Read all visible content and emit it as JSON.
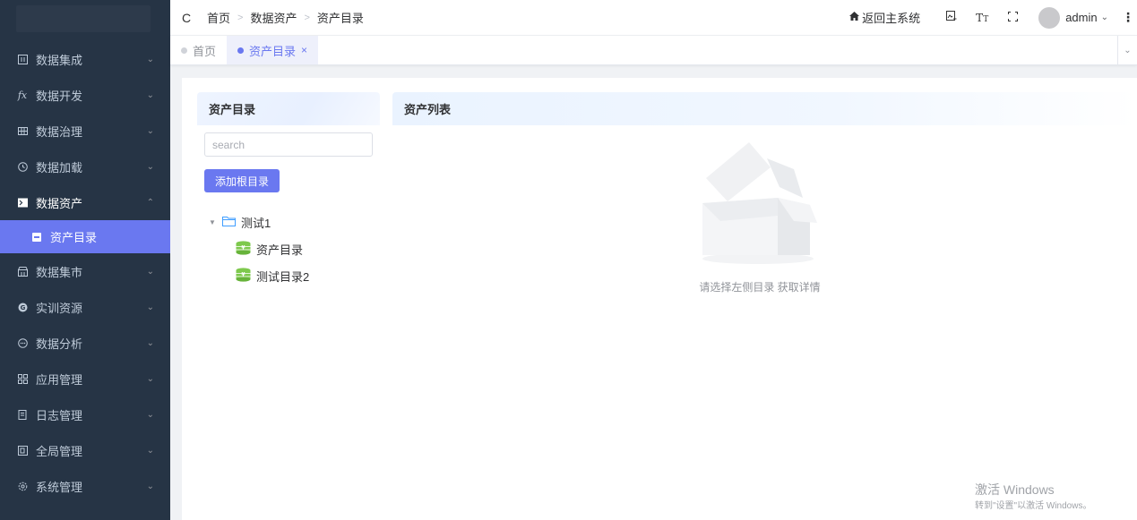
{
  "sidebar": {
    "items": [
      {
        "label": "数据集成",
        "icon": "grid-icon"
      },
      {
        "label": "数据开发",
        "icon": "fx-icon"
      },
      {
        "label": "数据治理",
        "icon": "table-icon"
      },
      {
        "label": "数据加载",
        "icon": "clock-icon"
      },
      {
        "label": "数据资产",
        "icon": "terminal-icon",
        "open": true
      },
      {
        "label": "数据集市",
        "icon": "store-icon"
      },
      {
        "label": "实训资源",
        "icon": "g-circle-icon"
      },
      {
        "label": "数据分析",
        "icon": "chat-icon"
      },
      {
        "label": "应用管理",
        "icon": "apps-icon"
      },
      {
        "label": "日志管理",
        "icon": "log-icon"
      },
      {
        "label": "全局管理",
        "icon": "global-icon"
      },
      {
        "label": "系统管理",
        "icon": "gear-icon"
      }
    ],
    "active_sub": "资产目录"
  },
  "navbar": {
    "breadcrumb": [
      "首页",
      "数据资产",
      "资产目录"
    ],
    "back_main": "返回主系统",
    "user": "admin"
  },
  "tags": [
    {
      "label": "首页",
      "active": false
    },
    {
      "label": "资产目录",
      "active": true
    }
  ],
  "left_panel": {
    "title": "资产目录",
    "search_placeholder": "search",
    "add_button": "添加根目录",
    "tree": {
      "root": "测试1",
      "children": [
        "资产目录",
        "测试目录2"
      ]
    }
  },
  "right_panel": {
    "title": "资产列表",
    "empty_text": "请选择左侧目录 获取详情"
  },
  "watermark": {
    "line1": "激活 Windows",
    "line2": "转到\"设置\"以激活 Windows。"
  },
  "colors": {
    "sidebar_bg": "#263445",
    "accent": "#6a78f0"
  }
}
